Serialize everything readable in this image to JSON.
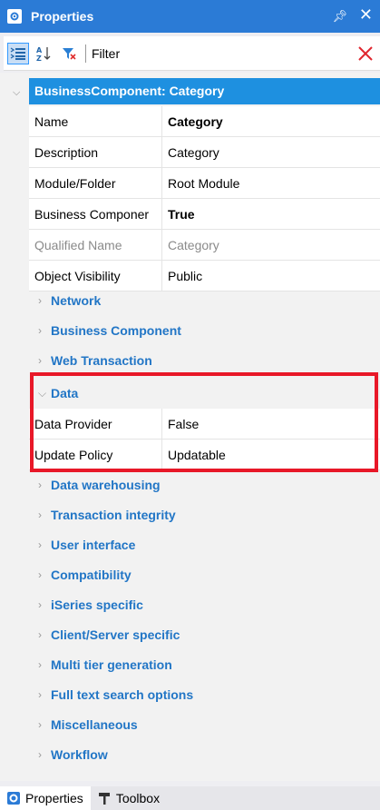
{
  "window": {
    "title": "Properties"
  },
  "toolbar": {
    "filter_label": "Filter",
    "filter_value": ""
  },
  "object_header": "BusinessComponent: Category",
  "properties": [
    {
      "name": "Name",
      "value": "Category",
      "bold": true,
      "dim": false
    },
    {
      "name": "Description",
      "value": "Category",
      "bold": false,
      "dim": false
    },
    {
      "name": "Module/Folder",
      "value": "Root Module",
      "bold": false,
      "dim": false
    },
    {
      "name": "Business Componer",
      "value": "True",
      "bold": true,
      "dim": false
    },
    {
      "name": "Qualified Name",
      "value": "Category",
      "bold": false,
      "dim": true
    },
    {
      "name": "Object Visibility",
      "value": "Public",
      "bold": false,
      "dim": false
    }
  ],
  "categories_before": [
    "Network",
    "Business Component",
    "Web Transaction"
  ],
  "data_section": {
    "label": "Data",
    "rows": [
      {
        "name": "Data Provider",
        "value": "False"
      },
      {
        "name": "Update Policy",
        "value": "Updatable"
      }
    ]
  },
  "categories_after": [
    "Data warehousing",
    "Transaction integrity",
    "User interface",
    "Compatibility",
    "iSeries specific",
    "Client/Server specific",
    "Multi tier generation",
    "Full text search options",
    "Miscellaneous",
    "Workflow"
  ],
  "bottom_tabs": [
    {
      "label": "Properties",
      "icon": "gear-icon",
      "active": true
    },
    {
      "label": "Toolbox",
      "icon": "hammer-icon",
      "active": false
    }
  ],
  "colors": {
    "titlebar": "#2b7bd6",
    "header": "#1e90e0",
    "category": "#2276c6",
    "highlight": "#e81828"
  }
}
